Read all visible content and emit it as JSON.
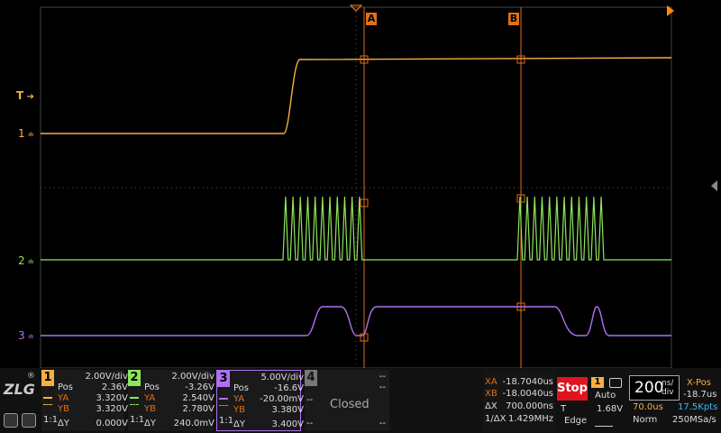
{
  "colors": {
    "ch1": "#f5b043",
    "ch2": "#8ee65a",
    "ch3": "#b070f0",
    "cursor": "#e0701a",
    "stop": "#e0141e",
    "accent": "#ff8c00",
    "skyblue": "#38b8ff"
  },
  "screen": {
    "trigger_marker": "T",
    "channel_markers": [
      "1",
      "2",
      "3"
    ],
    "cursor_labels": [
      "A",
      "B"
    ]
  },
  "channels": [
    {
      "num": "1",
      "scale": "2.00V/div",
      "pos_label": "Pos",
      "pos": "2.36V",
      "ya_label": "YA",
      "ya": "3.320V",
      "yb_label": "YB",
      "yb": "3.320V",
      "dy_label": "ΔY",
      "dy": "0.000V",
      "coupling": "1:1"
    },
    {
      "num": "2",
      "scale": "2.00V/div",
      "pos_label": "Pos",
      "pos": "-3.26V",
      "ya_label": "YA",
      "ya": "2.540V",
      "yb_label": "YB",
      "yb": "2.780V",
      "dy_label": "ΔY",
      "dy": "240.0mV",
      "coupling": "1:1"
    },
    {
      "num": "3",
      "scale": "5.00V/div",
      "pos_label": "Pos",
      "pos": "-16.6V",
      "ya_label": "YA",
      "ya": "-20.00mV",
      "yb_label": "YB",
      "yb": "3.380V",
      "dy_label": "ΔY",
      "dy": "3.400V",
      "coupling": "1:1"
    }
  ],
  "ch4": {
    "num": "4",
    "dash1": "--",
    "dash2": "--",
    "dash3": "--",
    "dash4": "--",
    "dash5": "--",
    "status": "Closed"
  },
  "cursors": {
    "xa_label": "XA",
    "xa": "-18.7040us",
    "xb_label": "XB",
    "xb": "-18.0040us",
    "dx_label": "ΔX",
    "dx": "700.000ns",
    "inv_label": "1/ΔX",
    "inv": "1.429MHz"
  },
  "run": {
    "state": "Stop",
    "trig_src": "1",
    "trig_mode": "Auto",
    "trig_label": "T",
    "trig_level": "1.68V",
    "trig_type": "Edge"
  },
  "timebase": {
    "value": "200",
    "unit_top": "ns/",
    "unit_bottom": "div",
    "delay": "70.0us",
    "mode": "Norm",
    "xpos_label": "X-Pos",
    "xpos": "-18.7us",
    "points": "17.5Kpts",
    "rate": "250MSa/s"
  }
}
